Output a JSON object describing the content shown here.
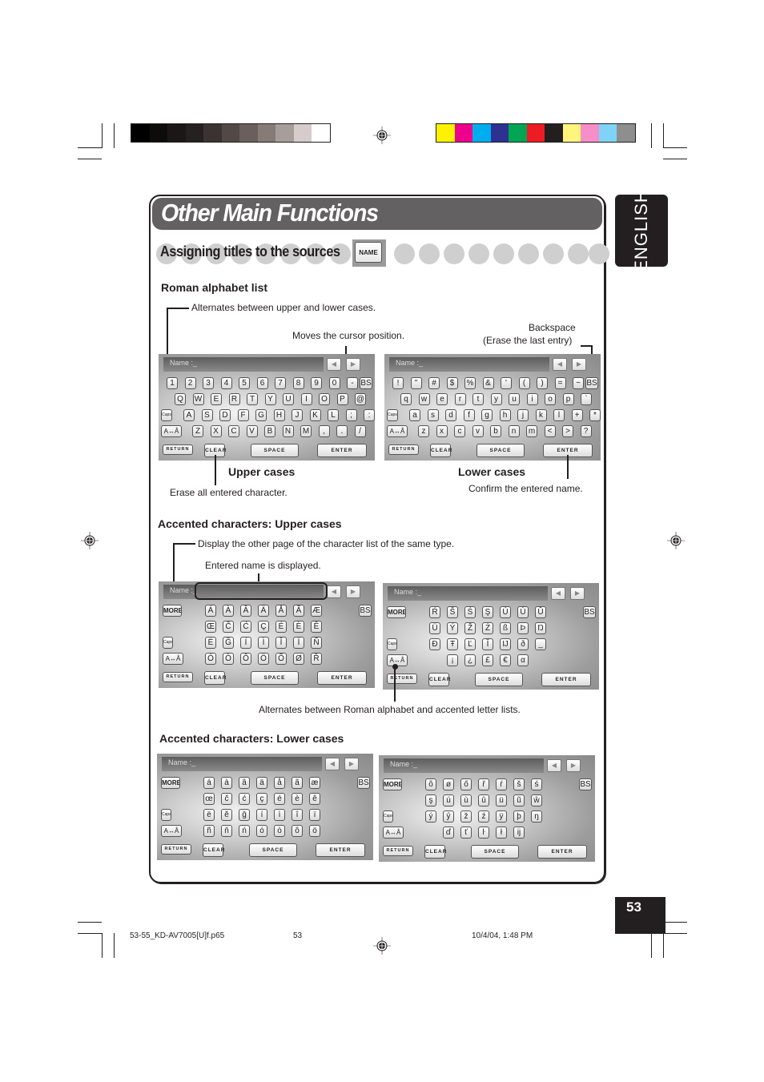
{
  "print_marks": {
    "grayscale_swatches": [
      "#000000",
      "#0e0c0b",
      "#1a1716",
      "#252120",
      "#3a3331",
      "#524946",
      "#6a5f5c",
      "#877b78",
      "#a79d9a",
      "#d5cccb",
      "#ffffff"
    ],
    "color_swatches": [
      "#fff200",
      "#ec008c",
      "#00aeef",
      "#2e3192",
      "#00a651",
      "#ed1c24",
      "#231f20",
      "#fff57c",
      "#f68fc8",
      "#7fd3f7",
      "#8e8e8e"
    ]
  },
  "header": {
    "title": "Other Main Functions",
    "language_tab": "ENGLISH"
  },
  "section": {
    "title": "Assigning titles to the sources",
    "name_button": "NAME"
  },
  "roman": {
    "heading": "Roman alphabet list",
    "note_caps": "Alternates between upper and lower cases.",
    "note_cursor": "Moves the cursor position.",
    "note_bs_line1": "Backspace",
    "note_bs_line2": "(Erase the last entry)",
    "label_upper": "Upper cases",
    "label_lower": "Lower cases",
    "note_clear": "Erase all entered character.",
    "note_enter": "Confirm the entered name."
  },
  "accent_upper": {
    "heading": "Accented characters: Upper cases",
    "note_more": "Display the other page of the character list of the same type.",
    "note_name": "Entered name is displayed.",
    "note_toggle": "Alternates between Roman alphabet and accented letter lists."
  },
  "accent_lower": {
    "heading": "Accented characters: Lower cases"
  },
  "keyboard_common": {
    "name_label": "Name :_",
    "name_label_empty": "Name :",
    "left_arrow": "◀",
    "right_arrow": "▶",
    "bs": "BS",
    "caps": "Caps",
    "toggle": "A↔Å",
    "more": "MORE",
    "return": "RETURN",
    "clear": "CLEAR",
    "space": "SPACE",
    "enter": "ENTER"
  },
  "keyboards": {
    "upper": {
      "rows": [
        [
          "1",
          "2",
          "3",
          "4",
          "5",
          "6",
          "7",
          "8",
          "9",
          "0",
          "-"
        ],
        [
          "Q",
          "W",
          "E",
          "R",
          "T",
          "Y",
          "U",
          "I",
          "O",
          "P",
          "@"
        ],
        [
          "A",
          "S",
          "D",
          "F",
          "G",
          "H",
          "J",
          "K",
          "L",
          ";",
          ":"
        ],
        [
          "Z",
          "X",
          "C",
          "V",
          "B",
          "N",
          "M",
          ",",
          ".",
          "/"
        ]
      ]
    },
    "lower": {
      "rows": [
        [
          "!",
          "\"",
          "#",
          "$",
          "%",
          "&",
          "'",
          "(",
          ")",
          "=",
          "~"
        ],
        [
          "q",
          "w",
          "e",
          "r",
          "t",
          "y",
          "u",
          "i",
          "o",
          "p",
          "`"
        ],
        [
          "a",
          "s",
          "d",
          "f",
          "g",
          "h",
          "j",
          "k",
          "l",
          "+",
          "*"
        ],
        [
          "z",
          "x",
          "c",
          "v",
          "b",
          "n",
          "m",
          "<",
          ">",
          "?"
        ]
      ]
    },
    "accent_upper_1": {
      "rows": [
        [
          "Á",
          "À",
          "Â",
          "Ä",
          "Å",
          "Ã",
          "Æ"
        ],
        [
          "Œ",
          "Č",
          "Ć",
          "Ç",
          "É",
          "È",
          "Ê"
        ],
        [
          "Ë",
          "Ğ",
          "Í",
          "Ì",
          "Î",
          "Ï",
          "Ñ"
        ],
        [
          "Ó",
          "Ò",
          "Ô",
          "Ö",
          "Õ",
          "Ø",
          "Ř"
        ]
      ]
    },
    "accent_upper_2": {
      "rows": [
        [
          "Ŕ",
          "Š",
          "Ś",
          "Ş",
          "Ú",
          "Ù",
          "Û"
        ],
        [
          "Ü",
          "Ý",
          "Ž",
          "Ż",
          "ß",
          "Þ",
          "Ŋ"
        ],
        [
          "Đ",
          "Ŧ",
          "Ľ",
          "Ĭ",
          "Ĳ",
          "ð",
          "_"
        ],
        [
          "¡",
          "¿",
          "£",
          "€",
          "α"
        ]
      ]
    },
    "accent_lower_1": {
      "rows": [
        [
          "á",
          "à",
          "â",
          "ä",
          "å",
          "ã",
          "æ"
        ],
        [
          "œ",
          "č",
          "ć",
          "ç",
          "é",
          "è",
          "ê"
        ],
        [
          "ë",
          "ĕ",
          "ğ",
          "í",
          "ì",
          "î",
          "ï"
        ],
        [
          "ñ",
          "ň",
          "ń",
          "ó",
          "ò",
          "ô",
          "ö"
        ]
      ]
    },
    "accent_lower_2": {
      "rows": [
        [
          "õ",
          "ø",
          "ő",
          "ř",
          "ŕ",
          "š",
          "ś"
        ],
        [
          "ş",
          "ú",
          "ù",
          "û",
          "ü",
          "ũ",
          "ŵ"
        ],
        [
          "ý",
          "ŷ",
          "ž",
          "ź",
          "ÿ",
          "þ",
          "ŋ"
        ],
        [
          "ď",
          "ť",
          "ŀ",
          "ł",
          "ĳ"
        ]
      ]
    }
  },
  "page_number": "53",
  "footer": {
    "file": "53-55_KD-AV7005[U]f.p65",
    "page": "53",
    "date": "10/4/04, 1:48 PM"
  }
}
